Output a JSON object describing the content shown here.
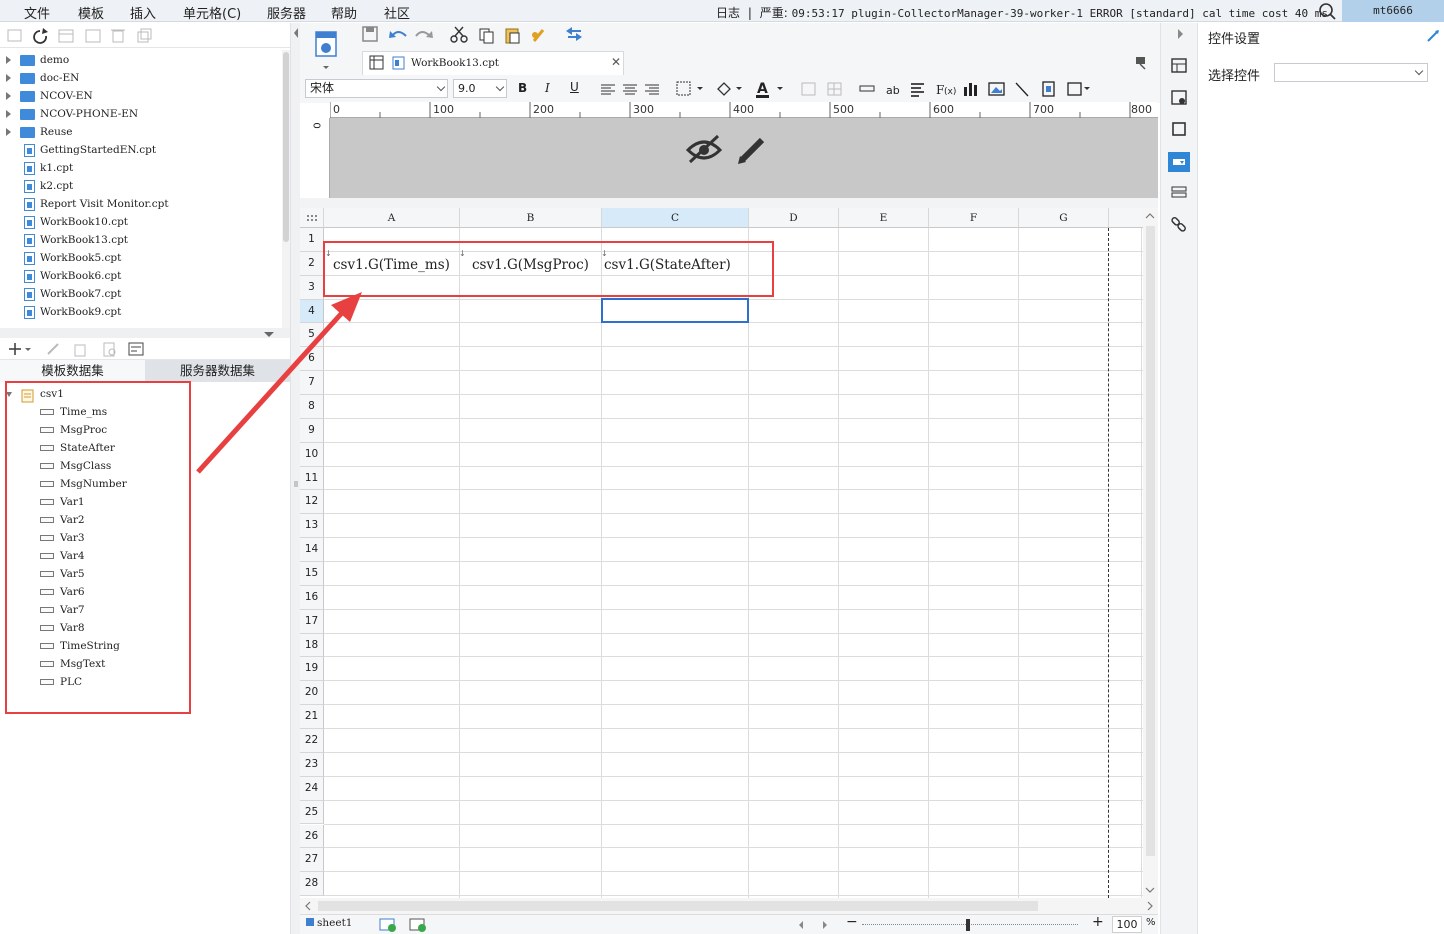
{
  "menu": [
    "文件",
    "模板",
    "插入",
    "单元格(C)",
    "服务器",
    "帮助",
    "社区"
  ],
  "log": {
    "label": "日志",
    "severity": "严重:",
    "message": "09:53:17 plugin-CollectorManager-39-worker-1 ERROR [standard] cal time cost 40 ms"
  },
  "user": "mt6666",
  "file_tree": [
    "demo",
    "doc-EN",
    "NCOV-EN",
    "NCOV-PHONE-EN",
    "Reuse",
    "GettingStartedEN.cpt",
    "k1.cpt",
    "k2.cpt",
    "Report Visit Monitor.cpt",
    "WorkBook10.cpt",
    "WorkBook13.cpt",
    "WorkBook5.cpt",
    "WorkBook6.cpt",
    "WorkBook7.cpt",
    "WorkBook9.cpt"
  ],
  "dataset_tabs": {
    "template": "模板数据集",
    "server": "服务器数据集"
  },
  "dataset": {
    "name": "csv1",
    "columns": [
      "Time_ms",
      "MsgProc",
      "StateAfter",
      "MsgClass",
      "MsgNumber",
      "Var1",
      "Var2",
      "Var3",
      "Var4",
      "Var5",
      "Var6",
      "Var7",
      "Var8",
      "TimeString",
      "MsgText",
      "PLC"
    ]
  },
  "file_tab": "WorkBook13.cpt",
  "font": {
    "family": "宋体",
    "size": "9.0"
  },
  "format_buttons": {
    "bold": "B",
    "italic": "I",
    "underline": "U"
  },
  "ruler": [
    "0",
    "100",
    "200",
    "300",
    "400",
    "500",
    "600",
    "700",
    "800"
  ],
  "vruler": "0",
  "columns": [
    "A",
    "B",
    "C",
    "D",
    "E",
    "F",
    "G"
  ],
  "rows": [
    "1",
    "2",
    "3",
    "4",
    "5",
    "6",
    "7",
    "8",
    "9",
    "10",
    "11",
    "12",
    "13",
    "14",
    "15",
    "16",
    "17",
    "18",
    "19",
    "20",
    "21",
    "22",
    "23",
    "24",
    "25",
    "26",
    "27",
    "28"
  ],
  "cells": {
    "A2": "csv1.G(Time_ms)",
    "B2": "csv1.G(MsgProc)",
    "C2": "csv1.G(StateAfter)"
  },
  "sheet": "sheet1",
  "zoom": "100",
  "zoom_unit": "%",
  "right_panel": {
    "title": "控件设置",
    "select_label": "选择控件"
  },
  "colors": {
    "annotation": "#e84040",
    "selection": "#2e6fcf",
    "folder": "#3f8bd9"
  }
}
